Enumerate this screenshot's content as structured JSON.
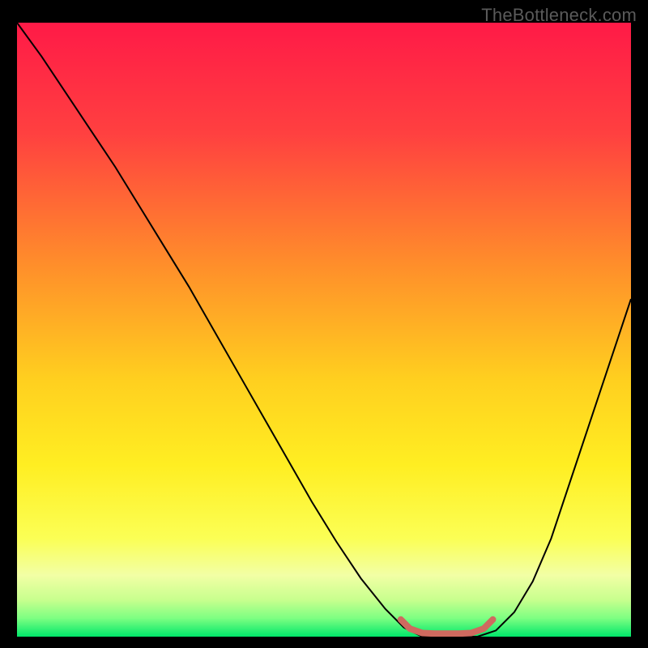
{
  "watermark": "TheBottleneck.com",
  "chart_data": {
    "type": "line",
    "title": "",
    "xlabel": "",
    "ylabel": "",
    "xlim": [
      0,
      100
    ],
    "ylim": [
      0,
      100
    ],
    "grid": false,
    "background_gradient": {
      "stops": [
        {
          "offset": 0.0,
          "color": "#ff1a47"
        },
        {
          "offset": 0.18,
          "color": "#ff4040"
        },
        {
          "offset": 0.4,
          "color": "#ff902a"
        },
        {
          "offset": 0.58,
          "color": "#ffcf1f"
        },
        {
          "offset": 0.72,
          "color": "#ffee22"
        },
        {
          "offset": 0.84,
          "color": "#fbff55"
        },
        {
          "offset": 0.9,
          "color": "#f2ffa5"
        },
        {
          "offset": 0.94,
          "color": "#c8ff8e"
        },
        {
          "offset": 0.97,
          "color": "#7dff82"
        },
        {
          "offset": 1.0,
          "color": "#00e76a"
        }
      ]
    },
    "series": [
      {
        "name": "bottleneck-curve",
        "stroke": "#000000",
        "stroke_width": 2,
        "x": [
          0,
          4,
          8,
          12,
          16,
          20,
          24,
          28,
          32,
          36,
          40,
          44,
          48,
          52,
          56,
          60,
          63,
          66,
          69,
          72,
          75,
          78,
          81,
          84,
          87,
          90,
          93,
          96,
          100
        ],
        "y": [
          100,
          94.5,
          88.5,
          82.5,
          76.5,
          70.0,
          63.5,
          57.0,
          50.0,
          43.0,
          36.0,
          29.0,
          22.0,
          15.5,
          9.5,
          4.5,
          1.5,
          0.0,
          0.0,
          0.0,
          0.0,
          1.0,
          4.0,
          9.0,
          16.0,
          25.0,
          34.0,
          43.0,
          55.0
        ]
      },
      {
        "name": "sweet-spot",
        "stroke": "#cf6a5f",
        "stroke_width": 8,
        "linecap": "round",
        "x": [
          62.5,
          64.0,
          66.0,
          68.0,
          70.0,
          72.0,
          74.0,
          76.0,
          77.5
        ],
        "y": [
          2.8,
          1.3,
          0.6,
          0.5,
          0.5,
          0.5,
          0.6,
          1.3,
          2.8
        ]
      }
    ]
  }
}
